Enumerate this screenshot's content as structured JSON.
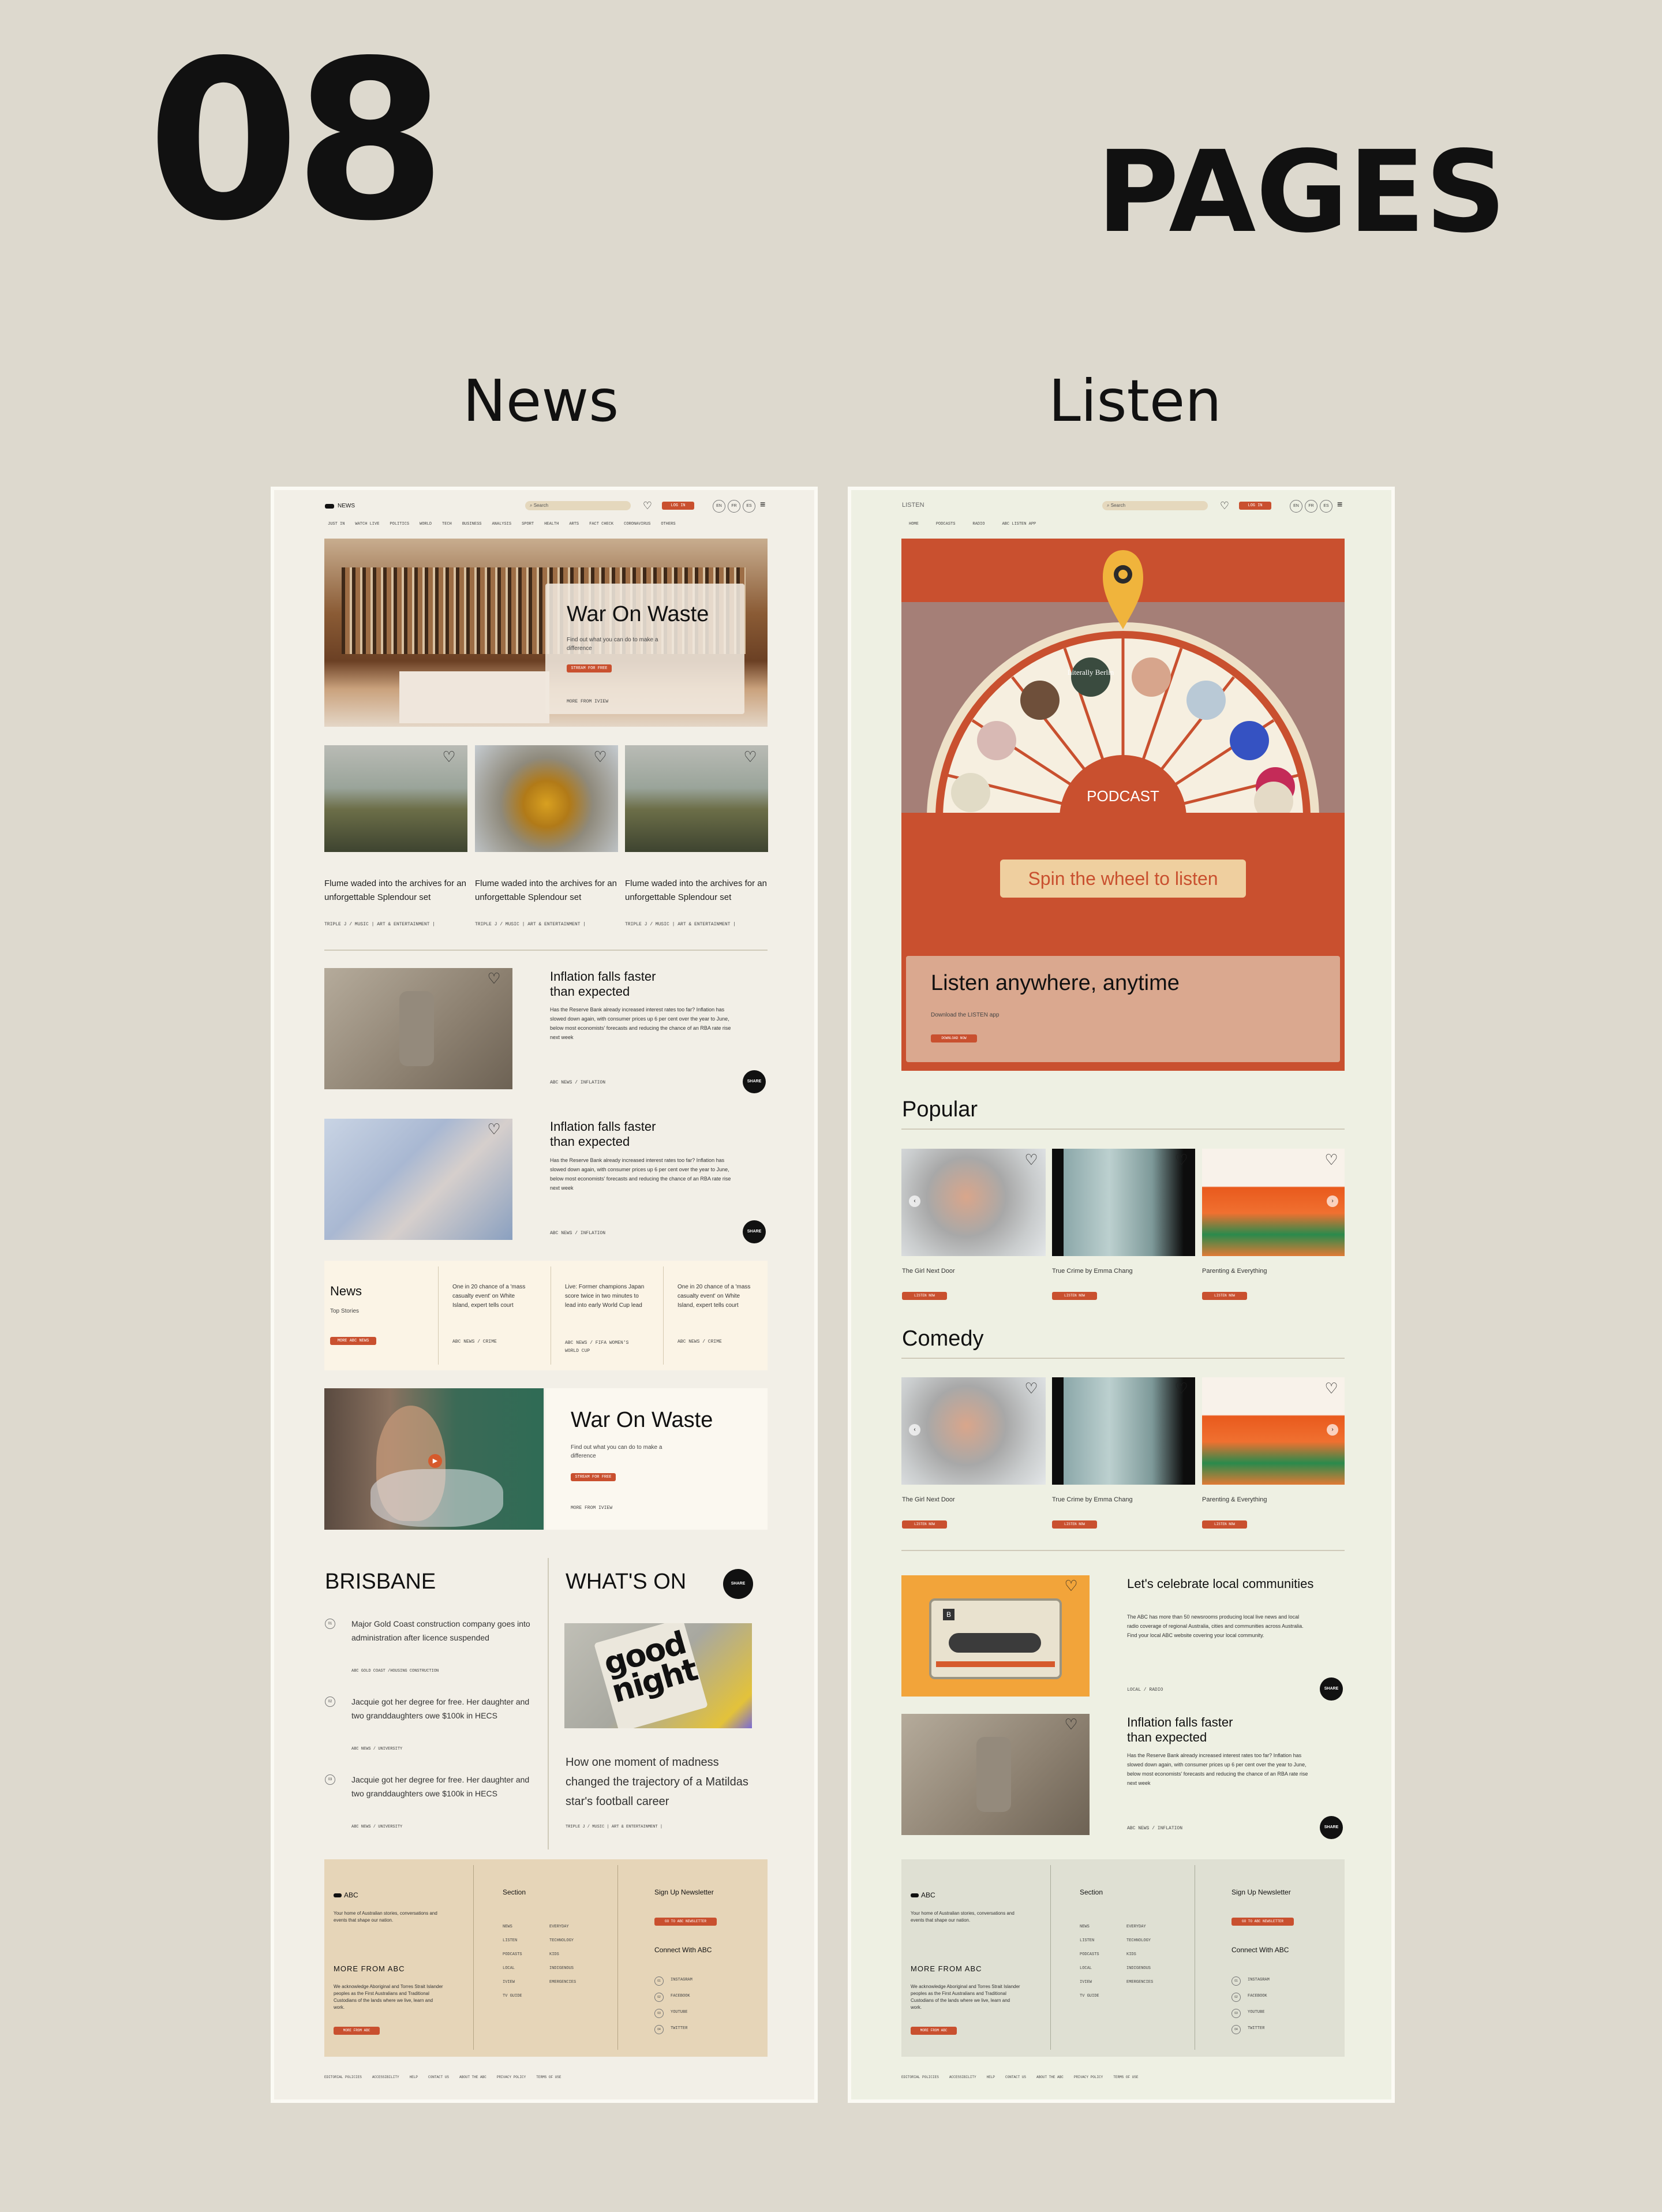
{
  "heading": {
    "number": "08",
    "label": "PAGES"
  },
  "columns": {
    "news": "News",
    "listen": "Listen"
  },
  "news": {
    "logo": "NEWS",
    "search_placeholder": "Search",
    "login": "LOG IN",
    "lang": [
      "EN",
      "FR",
      "ES"
    ],
    "nav": [
      "JUST IN",
      "WATCH LIVE",
      "POLITICS",
      "WORLD",
      "TECH",
      "BUSINESS",
      "ANALYSIS",
      "SPORT",
      "HEALTH",
      "ARTS",
      "FACT CHECK",
      "CORONAVIRUS",
      "OTHERS"
    ],
    "hero": {
      "title": "War On Waste",
      "desc": "Find out what you can do to make a difference",
      "cta": "STREAM FOR FREE",
      "more": "MORE FROM IVIEW"
    },
    "cards": [
      {
        "title": "Flume waded into the archives for an unforgettable Splendour set",
        "tag": "TRIPLE J / MUSIC | ART & ENTERTAINMENT |"
      },
      {
        "title": "Flume waded into the archives for an unforgettable Splendour set",
        "tag": "TRIPLE J / MUSIC | ART & ENTERTAINMENT |"
      },
      {
        "title": "Flume waded into the archives for an unforgettable Splendour set",
        "tag": "TRIPLE J / MUSIC | ART & ENTERTAINMENT |"
      }
    ],
    "articles": [
      {
        "title": "Inflation falls faster than expected",
        "body": "Has the Reserve Bank already increased interest rates too far? Inflation has slowed down again, with consumer prices up 6 per cent over the year to June, below most economists' forecasts and reducing the chance of an RBA rate rise next week",
        "tag": "ABC NEWS / INFLATION",
        "share": "SHARE"
      },
      {
        "title": "Inflation falls faster than expected",
        "body": "Has the Reserve Bank already increased interest rates too far? Inflation has slowed down again, with consumer prices up 6 per cent over the year to June, below most economists' forecasts and reducing the chance of an RBA rate rise next week",
        "tag": "ABC NEWS / INFLATION",
        "share": "SHARE"
      }
    ],
    "top": {
      "title": "News",
      "sub": "Top Stories",
      "btn": "MORE ABC NEWS",
      "items": [
        {
          "text": "One in 20 chance of a 'mass casualty event' on White Island, expert tells court",
          "tag": "ABC NEWS / CRIME"
        },
        {
          "text": "Live: Former champions Japan score twice in two minutes to lead into early World Cup lead",
          "tag": "ABC NEWS / FIFA WOMEN'S WORLD CUP"
        },
        {
          "text": "One in 20 chance of a 'mass casualty event' on White Island, expert tells court",
          "tag": "ABC NEWS / CRIME"
        }
      ]
    },
    "feature": {
      "title": "War On Waste",
      "desc": "Find out what you can do to make a difference",
      "cta": "STREAM FOR FREE",
      "more": "MORE FROM IVIEW"
    },
    "brisbane": {
      "title": "BRISBANE",
      "items": [
        {
          "num": "01",
          "text": "Major Gold Coast construction company goes into administration after licence suspended",
          "tag": "ABC GOLD COAST /HOUSING CONSTRUCTION"
        },
        {
          "num": "02",
          "text": "Jacquie got her degree for free. Her daughter and two granddaughters owe $100k in HECS",
          "tag": "ABC NEWS / UNIVERSITY"
        },
        {
          "num": "03",
          "text": "Jacquie got her degree for free. Her daughter and two granddaughters owe $100k in HECS",
          "tag": "ABC NEWS / UNIVERSITY"
        }
      ]
    },
    "whatson": {
      "title": "WHAT'S ON",
      "share": "SHARE",
      "img_text": "good night",
      "text": "How one moment of madness changed the trajectory of a Matildas star's football career",
      "tag": "TRIPLE J / MUSIC | ART & ENTERTAINMENT |"
    }
  },
  "listen": {
    "logo": "LISTEN",
    "search_placeholder": "Search",
    "login": "LOG IN",
    "lang": [
      "EN",
      "FR",
      "ES"
    ],
    "nav": [
      "HOME",
      "PODCASTS",
      "RADIO",
      "ABC LISTEN APP"
    ],
    "wheel_center": "PODCAST",
    "wheel_label": "Literally Berlin",
    "spin": "Spin the wheel to listen",
    "app": {
      "title": "Listen anywhere, anytime",
      "sub": "Download the LISTEN app",
      "btn": "DOWNLOAD NOW"
    },
    "popular": {
      "title": "Popular",
      "items": [
        {
          "title": "The Girl Next Door",
          "btn": "LISTEN NOW"
        },
        {
          "title": "True Crime by Emma Chang",
          "btn": "LISTEN NOW"
        },
        {
          "title": "Parenting & Everything",
          "btn": "LISTEN NOW"
        }
      ]
    },
    "comedy": {
      "title": "Comedy",
      "items": [
        {
          "title": "The Girl Next Door",
          "btn": "LISTEN NOW"
        },
        {
          "title": "True Crime by Emma Chang",
          "btn": "LISTEN NOW"
        },
        {
          "title": "Parenting & Everything",
          "btn": "LISTEN NOW"
        }
      ]
    },
    "articles": [
      {
        "title": "Let's celebrate local communities",
        "body": "The ABC has more than 50 newsrooms producing local live news and local radio coverage of regional Australia, cities and communities across Australia. Find your local ABC website covering your local community.",
        "tag": "LOCAL / RADIO",
        "share": "SHARE"
      },
      {
        "title": "Inflation falls faster than expected",
        "body": "Has the Reserve Bank already increased interest rates too far? Inflation has slowed down again, with consumer prices up 6 per cent over the year to June, below most economists' forecasts and reducing the chance of an RBA rate rise next week",
        "tag": "ABC NEWS / INFLATION",
        "share": "SHARE"
      }
    ]
  },
  "footer": {
    "logo": "ABC",
    "about": "Your home of Australian stories, conversations and events that shape our nation.",
    "more": "MORE FROM ABC",
    "ack": "We acknowledge Aboriginal and Torres Strait Islander peoples as the First Australians and Traditional Custodians of the lands where we live, learn and work.",
    "more_btn": "MORE FROM ABC",
    "section_title": "Section",
    "section_col1": [
      "NEWS",
      "LISTEN",
      "PODCASTS",
      "LOCAL",
      "IVIEW",
      "TV GUIDE"
    ],
    "section_col2": [
      "EVERYDAY",
      "TECHNOLOGY",
      "KIDS",
      "INDIGENOUS",
      "EMERGENCIES"
    ],
    "newsletter": "Sign Up Newsletter",
    "newsletter_btn": "GO TO ABC NEWSLETTER",
    "connect": "Connect With ABC",
    "social": [
      {
        "num": "01",
        "name": "INSTAGRAM"
      },
      {
        "num": "02",
        "name": "FACEBOOK"
      },
      {
        "num": "03",
        "name": "YOUTUBE"
      },
      {
        "num": "04",
        "name": "TWITTER"
      }
    ],
    "links": [
      "EDITORIAL POLICIES",
      "ACCESSIBILITY",
      "HELP",
      "CONTACT US",
      "ABOUT THE ABC",
      "PRIVACY POLICY",
      "TERMS OF USE"
    ]
  }
}
